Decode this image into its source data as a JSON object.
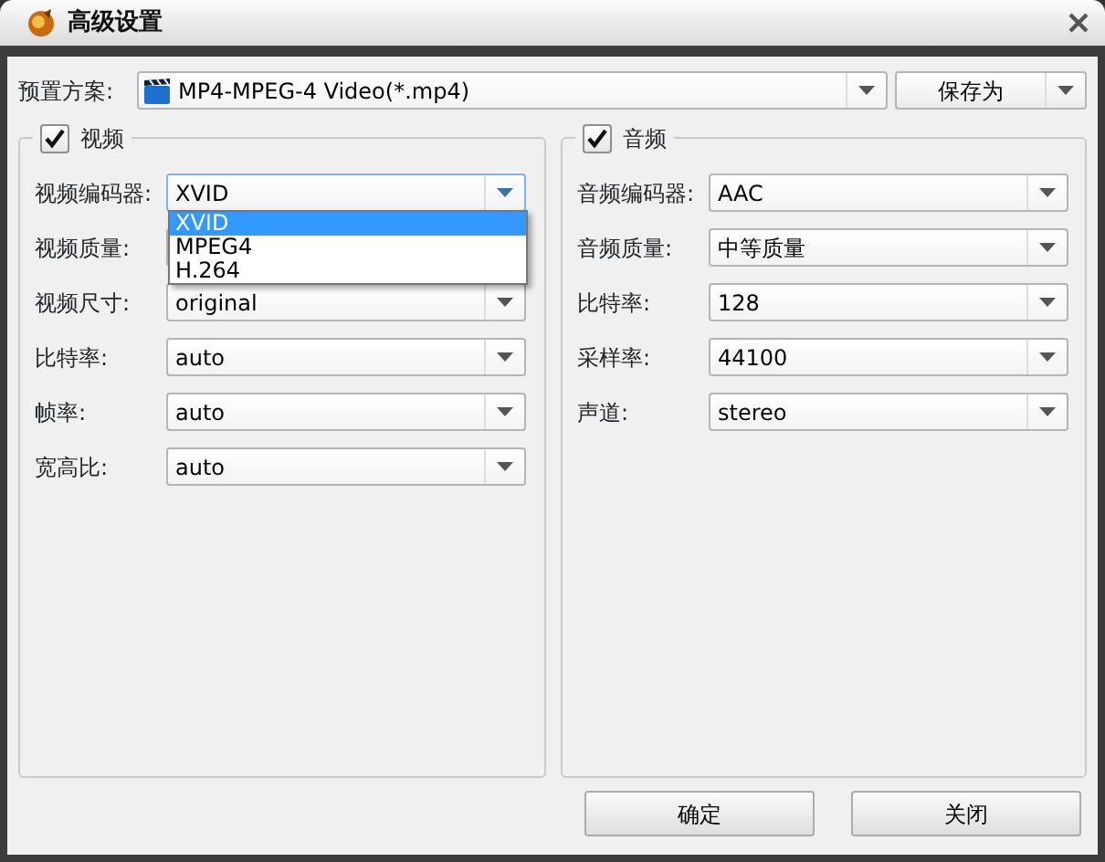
{
  "window": {
    "title": "高级设置"
  },
  "preset": {
    "label": "预置方案:",
    "value": "MP4-MPEG-4 Video(*.mp4)"
  },
  "save_as": {
    "label": "保存为"
  },
  "groups": [
    {
      "title": "视频",
      "checked": true,
      "fields": [
        {
          "label": "视频编码器:",
          "value": "XVID",
          "open": true,
          "options": [
            {
              "label": "XVID",
              "selected": true
            },
            {
              "label": "MPEG4",
              "selected": false
            },
            {
              "label": "H.264",
              "selected": false
            }
          ]
        },
        {
          "label": "视频质量:",
          "open": false
        },
        {
          "label": "视频尺寸:",
          "value": "original",
          "open": false
        },
        {
          "label": "比特率:",
          "value": "auto",
          "open": false
        },
        {
          "label": "帧率:",
          "value": "auto",
          "open": false
        },
        {
          "label": "宽高比:",
          "value": "auto",
          "open": false
        }
      ]
    },
    {
      "title": "音频",
      "checked": true,
      "fields": [
        {
          "label": "音频编码器:",
          "value": "AAC",
          "open": false
        },
        {
          "label": "音频质量:",
          "value": "中等质量",
          "open": false
        },
        {
          "label": "比特率:",
          "value": "128",
          "open": false
        },
        {
          "label": "采样率:",
          "value": "44100",
          "open": false
        },
        {
          "label": "声道:",
          "value": "stereo",
          "open": false
        }
      ]
    }
  ],
  "buttons": [
    "确定",
    "关闭"
  ]
}
